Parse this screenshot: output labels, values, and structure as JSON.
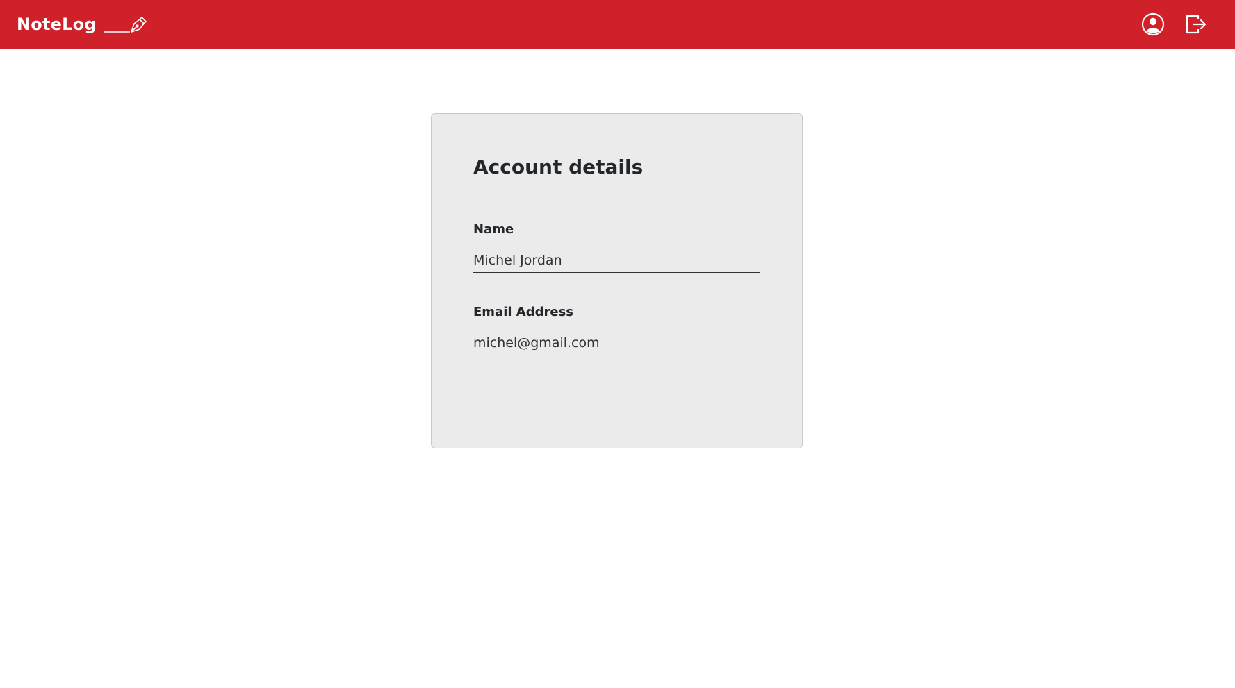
{
  "navbar": {
    "brand_text": "NoteLog",
    "brand_icon": "pen-nib-icon",
    "background_color": "#d0202a",
    "profile_icon": "user-circle-icon",
    "logout_icon": "logout-icon"
  },
  "account": {
    "title": "Account details",
    "name_label": "Name",
    "name_value": "Michel Jordan",
    "email_label": "Email Address",
    "email_value": "michel@gmail.com"
  }
}
